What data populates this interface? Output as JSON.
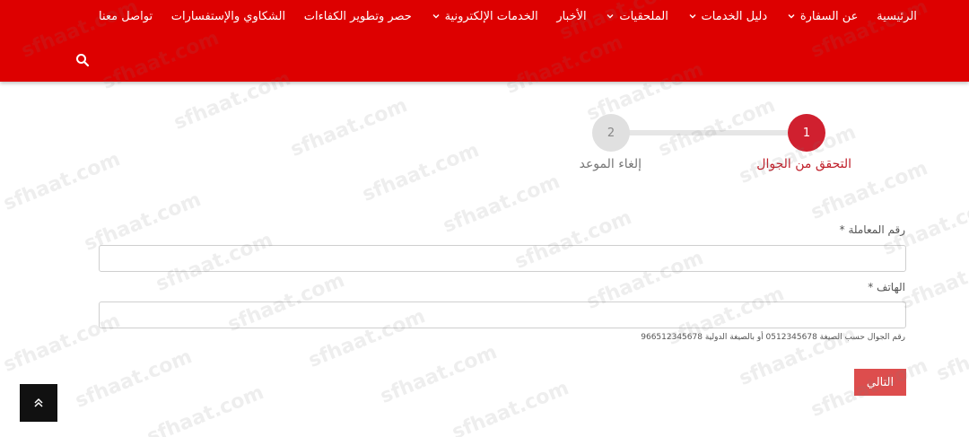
{
  "nav": {
    "items": [
      {
        "label": "الرئيسية",
        "has_dropdown": false
      },
      {
        "label": "عن السفارة",
        "has_dropdown": true
      },
      {
        "label": "دليل الخدمات",
        "has_dropdown": true
      },
      {
        "label": "الملحقيات",
        "has_dropdown": true
      },
      {
        "label": "الأخبار",
        "has_dropdown": false
      },
      {
        "label": "الخدمات الإلكترونية",
        "has_dropdown": true
      },
      {
        "label": "حصر وتطوير الكفاءات",
        "has_dropdown": false
      },
      {
        "label": "الشكاوي والإستفسارات",
        "has_dropdown": false
      },
      {
        "label": "تواصل معنا",
        "has_dropdown": false
      }
    ],
    "search_icon": "search-icon"
  },
  "stepper": {
    "step1_number": "1",
    "step1_label": "التحقق من الجوال",
    "step2_number": "2",
    "step2_label": "إلغاء الموعد",
    "active_color": "#d0202f"
  },
  "form": {
    "transaction_label": "رقم المعاملة",
    "transaction_value": "",
    "phone_label": "الهاتف",
    "phone_value": "",
    "required_mark": "*",
    "phone_hint": "رقم الجوال حسب الصيغة 0512345678 أو بالصيغة الدولية 966512345678",
    "next_button": "التالي"
  },
  "colors": {
    "header_bg": "#dd0000",
    "button_bg": "#dd4d4d"
  },
  "watermark": "sfhaat.com",
  "scroll_top_icon": "double-chevron-up-icon"
}
